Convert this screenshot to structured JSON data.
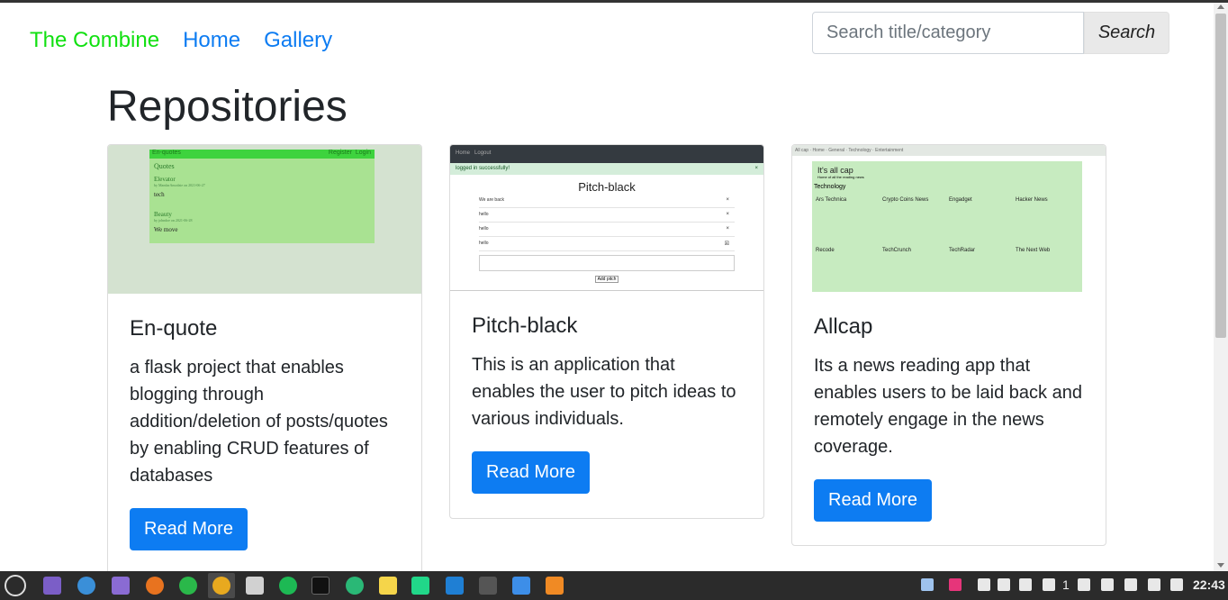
{
  "nav": {
    "brand": "The Combine",
    "links": [
      "Home",
      "Gallery"
    ]
  },
  "search": {
    "placeholder": "Search title/category",
    "button": "Search"
  },
  "page_title": "Repositories",
  "cards": [
    {
      "title": "En-quote",
      "description": "a flask project that enables blogging through addition/deletion of posts/quotes by enabling CRUD features of databases",
      "button": "Read More",
      "thumbnail": {
        "bar_title": "En-quotes",
        "bar_links": [
          "Register",
          "Login"
        ],
        "heading": "Quotes",
        "posts": [
          {
            "title": "Elevator",
            "meta": "by MandarAmodzie on 2021-06-27",
            "body": "tech"
          },
          {
            "title": "Beauty",
            "meta": "by johndoe on 2021-06-28",
            "body": "We move"
          }
        ]
      }
    },
    {
      "title": "Pitch-black",
      "description": "This is an application that enables the user to pitch ideas to various individuals.",
      "button": "Read More",
      "thumbnail": {
        "nav": [
          "Home",
          "Logout"
        ],
        "alert": "logged in successfully!",
        "heading": "Pitch-black",
        "rows": [
          "We are back",
          "hello",
          "hello",
          "hello"
        ],
        "button": "Add pitch"
      }
    },
    {
      "title": "Allcap",
      "description": "Its a news reading app that enables users to be laid back and remotely engage in the news coverage.",
      "button": "Read More",
      "thumbnail": {
        "heading": "It's all cap",
        "sub": "Home of all the reading news",
        "section": "Technology",
        "sources": [
          "Ars Technica",
          "Crypto Coins News",
          "Engadget",
          "Hacker News",
          "Recode",
          "TechCrunch",
          "TechRadar",
          "The Next Web"
        ]
      }
    }
  ],
  "taskbar": {
    "tray_count": "1",
    "clock": "22:43"
  }
}
